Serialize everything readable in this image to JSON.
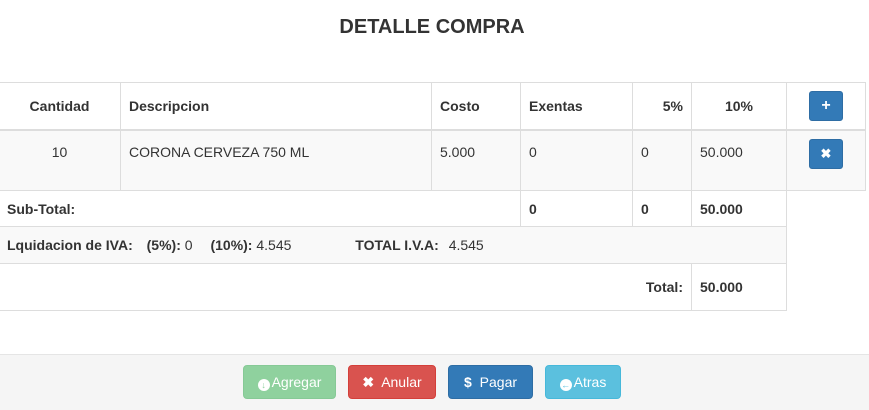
{
  "title": "DETALLE COMPRA",
  "table": {
    "headers": [
      "Cantidad",
      "Descripcion",
      "Costo",
      "Exentas",
      "5%",
      "10%"
    ],
    "add_button": "+",
    "rows": [
      {
        "cantidad": "10",
        "descripcion": "CORONA CERVEZA 750 ML",
        "costo": "5.000",
        "exentas": "0",
        "cinco": "0",
        "diez": "50.000",
        "remove_button": "✖"
      }
    ]
  },
  "subtotal": {
    "label": "Sub-Total:",
    "exentas": "0",
    "cinco": "0",
    "diez": "50.000"
  },
  "iva": {
    "label": "Lquidacion de IVA:",
    "five_label": "(5%):",
    "five_value": "0",
    "ten_label": "(10%):",
    "ten_value": "4.545",
    "total_label": "TOTAL I.V.A:",
    "total_value": "4.545"
  },
  "total": {
    "label": "Total:",
    "value": "50.000"
  },
  "footer": {
    "agregar": "Agregar",
    "anular": "Anular",
    "pagar": "Pagar",
    "atras": "Atras",
    "colors": {
      "agregar": "#8fd19e",
      "anular": "#d9534f",
      "pagar": "#337ab7",
      "atras": "#5bc0de"
    }
  }
}
